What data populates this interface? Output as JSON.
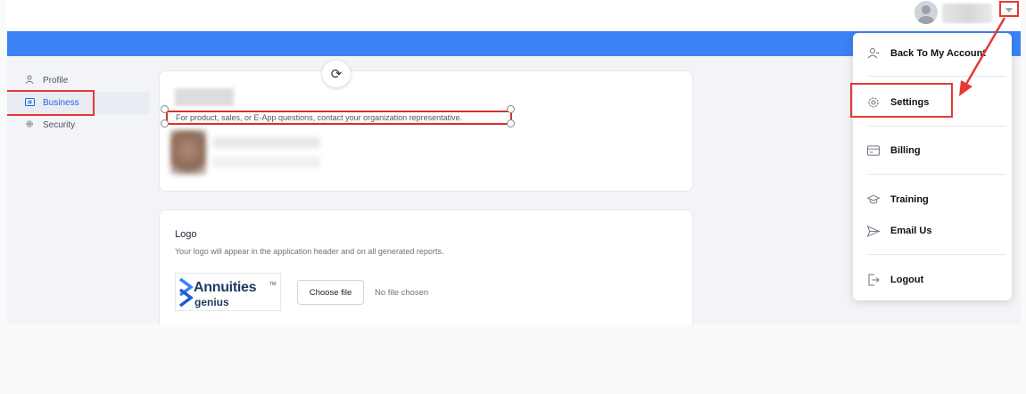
{
  "sidebar": {
    "items": [
      {
        "label": "Profile",
        "icon": "user-icon"
      },
      {
        "label": "Business",
        "icon": "id-card-icon",
        "active": true
      },
      {
        "label": "Security",
        "icon": "gear-icon"
      }
    ]
  },
  "business_card": {
    "contact_note": "For product, sales, or E-App questions, contact your organization representative."
  },
  "logo_card": {
    "title": "Logo",
    "description": "Your logo will appear in the application header and on all generated reports.",
    "logo_text_main": "Annuities",
    "logo_text_tm": "TM",
    "logo_text_sub": "genius",
    "choose_file_label": "Choose file",
    "file_status": "No file chosen"
  },
  "user_menu": {
    "items": [
      {
        "label": "Back To My Account",
        "icon": "user-back-icon"
      },
      {
        "label": "Settings",
        "icon": "gear-icon"
      },
      {
        "label": "Billing",
        "icon": "credit-card-icon"
      },
      {
        "label": "Training",
        "icon": "graduation-cap-icon"
      },
      {
        "label": "Email Us",
        "icon": "send-icon"
      },
      {
        "label": "Logout",
        "icon": "logout-icon"
      }
    ]
  },
  "colors": {
    "accent": "#3b82f6",
    "highlight": "#e53935",
    "active_link": "#2563eb"
  }
}
